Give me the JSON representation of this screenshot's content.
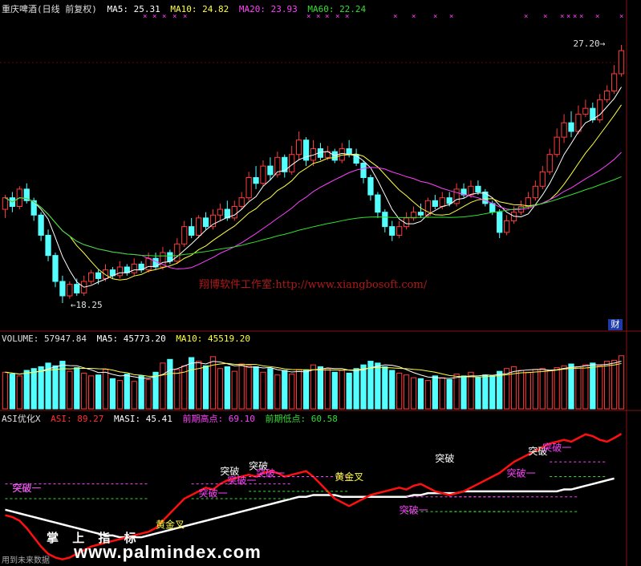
{
  "header": {
    "title": "重庆啤酒(日线 前复权)",
    "ma5": "MA5: 25.31",
    "ma10": "MA10: 24.82",
    "ma20": "MA20: 23.93",
    "ma60": "MA60: 22.24"
  },
  "volume_header": {
    "volume": "VOLUME: 57947.84",
    "ma5": "MA5: 45773.20",
    "ma10": "MA10: 45519.20"
  },
  "asi_header": {
    "name": "ASI优化X",
    "asi": "ASI: 89.27",
    "masi": "MASI: 45.41",
    "prev_high": "前期高点: 69.10",
    "prev_low": "前期低点: 60.58"
  },
  "watermark": "翔博软件工作室:http://www.xiangbosoft.com/",
  "finance_badge": "财",
  "logo_text": "掌 上 指 标",
  "site_text": "www.palmindex.com",
  "footer_text": "用到未来数据",
  "colors": {
    "up": "#ff3b3b",
    "down": "#54ffff",
    "ma5": "#ffffff",
    "ma10": "#ffff40",
    "ma20": "#ff40ff",
    "ma60": "#30e030",
    "asi": "#ff1010",
    "masi": "#ffffff",
    "grid": "#8a1010"
  },
  "chart_data": [
    {
      "type": "candlestick",
      "title": "重庆啤酒(日线 前复权)",
      "annotations": [
        {
          "label": "18.25",
          "kind": "low"
        },
        {
          "label": "27.20",
          "kind": "high"
        }
      ],
      "y_range": [
        17.5,
        28.2
      ],
      "candles": [
        [
          21.5,
          21.9,
          21.2,
          22.0
        ],
        [
          21.9,
          21.6,
          21.4,
          22.1
        ],
        [
          21.6,
          22.2,
          21.5,
          22.3
        ],
        [
          22.2,
          21.8,
          21.7,
          22.4
        ],
        [
          21.8,
          21.3,
          21.1,
          21.9
        ],
        [
          21.3,
          20.6,
          20.4,
          21.4
        ],
        [
          20.6,
          19.9,
          19.7,
          20.8
        ],
        [
          19.9,
          19.0,
          18.8,
          20.0
        ],
        [
          19.0,
          18.5,
          18.25,
          19.2
        ],
        [
          18.5,
          18.9,
          18.4,
          19.0
        ],
        [
          18.9,
          18.6,
          18.5,
          19.1
        ],
        [
          18.6,
          19.0,
          18.5,
          19.2
        ],
        [
          19.0,
          19.3,
          18.9,
          19.4
        ],
        [
          19.3,
          19.1,
          18.9,
          19.4
        ],
        [
          19.1,
          19.4,
          19.0,
          19.6
        ],
        [
          19.4,
          19.2,
          19.1,
          19.5
        ],
        [
          19.2,
          19.5,
          19.1,
          19.7
        ],
        [
          19.5,
          19.3,
          19.2,
          19.6
        ],
        [
          19.3,
          19.6,
          19.2,
          19.8
        ],
        [
          19.6,
          19.4,
          19.3,
          19.7
        ],
        [
          19.4,
          19.8,
          19.3,
          20.0
        ],
        [
          19.8,
          19.5,
          19.4,
          20.0
        ],
        [
          19.5,
          20.0,
          19.4,
          20.2
        ],
        [
          20.0,
          19.7,
          19.6,
          20.1
        ],
        [
          19.7,
          20.3,
          19.6,
          20.5
        ],
        [
          20.3,
          20.9,
          20.2,
          21.1
        ],
        [
          20.9,
          20.6,
          20.5,
          21.2
        ],
        [
          20.6,
          21.2,
          20.5,
          21.3
        ],
        [
          21.2,
          20.9,
          20.8,
          21.4
        ],
        [
          20.9,
          21.3,
          20.8,
          21.5
        ],
        [
          21.3,
          21.5,
          21.1,
          21.7
        ],
        [
          21.5,
          21.2,
          21.1,
          21.8
        ],
        [
          21.2,
          21.6,
          21.1,
          21.8
        ],
        [
          21.6,
          21.9,
          21.5,
          22.1
        ],
        [
          21.9,
          22.6,
          21.8,
          22.8
        ],
        [
          22.6,
          22.4,
          22.2,
          23.0
        ],
        [
          22.4,
          23.0,
          22.3,
          23.2
        ],
        [
          23.0,
          22.7,
          22.5,
          23.3
        ],
        [
          22.7,
          23.3,
          22.6,
          23.5
        ],
        [
          23.3,
          22.8,
          22.6,
          23.4
        ],
        [
          22.8,
          23.4,
          22.7,
          23.7
        ],
        [
          23.4,
          23.9,
          23.2,
          24.2
        ],
        [
          23.9,
          23.2,
          23.0,
          24.0
        ],
        [
          23.2,
          23.6,
          23.0,
          23.9
        ],
        [
          23.6,
          23.3,
          23.2,
          23.8
        ],
        [
          23.3,
          23.5,
          23.2,
          23.7
        ],
        [
          23.5,
          23.2,
          23.1,
          23.6
        ],
        [
          23.2,
          23.6,
          23.1,
          23.8
        ],
        [
          23.6,
          23.4,
          23.3,
          23.9
        ],
        [
          23.4,
          23.1,
          23.0,
          23.6
        ],
        [
          23.1,
          22.6,
          22.4,
          23.2
        ],
        [
          22.6,
          22.0,
          21.8,
          22.7
        ],
        [
          22.0,
          21.4,
          21.2,
          22.1
        ],
        [
          21.4,
          20.9,
          20.7,
          21.5
        ],
        [
          20.9,
          20.6,
          20.4,
          21.1
        ],
        [
          20.6,
          20.9,
          20.5,
          21.1
        ],
        [
          20.9,
          21.2,
          20.8,
          21.4
        ],
        [
          21.2,
          21.4,
          21.1,
          21.6
        ],
        [
          21.4,
          21.3,
          21.2,
          21.7
        ],
        [
          21.3,
          21.8,
          21.2,
          21.9
        ],
        [
          21.8,
          21.6,
          21.5,
          22.0
        ],
        [
          21.6,
          21.9,
          21.5,
          22.1
        ],
        [
          21.9,
          21.7,
          21.6,
          22.1
        ],
        [
          21.7,
          22.2,
          21.6,
          22.4
        ],
        [
          22.2,
          22.0,
          21.9,
          22.4
        ],
        [
          22.0,
          22.3,
          21.9,
          22.5
        ],
        [
          22.3,
          22.1,
          22.0,
          22.5
        ],
        [
          22.1,
          21.7,
          21.6,
          22.2
        ],
        [
          21.7,
          21.4,
          21.3,
          21.8
        ],
        [
          21.4,
          20.7,
          20.5,
          21.5
        ],
        [
          20.7,
          21.1,
          20.6,
          21.3
        ],
        [
          21.1,
          21.4,
          21.0,
          21.6
        ],
        [
          21.4,
          21.6,
          21.3,
          21.8
        ],
        [
          21.6,
          21.9,
          21.5,
          22.1
        ],
        [
          21.9,
          22.3,
          21.8,
          22.5
        ],
        [
          22.3,
          22.8,
          22.2,
          23.0
        ],
        [
          22.8,
          23.4,
          22.7,
          23.6
        ],
        [
          23.4,
          24.0,
          23.3,
          24.3
        ],
        [
          24.0,
          24.5,
          23.8,
          24.8
        ],
        [
          24.5,
          24.2,
          24.0,
          24.9
        ],
        [
          24.2,
          24.8,
          24.1,
          25.1
        ],
        [
          24.8,
          25.0,
          24.7,
          25.3
        ],
        [
          25.0,
          24.6,
          24.5,
          25.2
        ],
        [
          24.6,
          25.3,
          24.5,
          25.5
        ],
        [
          25.3,
          25.6,
          25.2,
          25.8
        ],
        [
          25.6,
          26.2,
          25.5,
          26.5
        ],
        [
          26.2,
          27.0,
          26.1,
          27.2
        ]
      ]
    },
    {
      "type": "bar",
      "title": "VOLUME",
      "y_range": [
        0,
        70000
      ],
      "values": [
        40000,
        38000,
        36000,
        42000,
        44000,
        46000,
        50000,
        47000,
        52000,
        41000,
        45000,
        39000,
        36000,
        37000,
        43000,
        33000,
        31000,
        38000,
        30000,
        36000,
        32000,
        40000,
        50000,
        54000,
        43000,
        47000,
        56000,
        52000,
        47000,
        57000,
        44000,
        46000,
        41000,
        49000,
        47000,
        46000,
        40000,
        44000,
        37000,
        42000,
        38000,
        43000,
        42000,
        48000,
        46000,
        44000,
        40000,
        42000,
        39000,
        44000,
        48000,
        52000,
        50000,
        46000,
        42000,
        39000,
        37000,
        34000,
        33000,
        31000,
        36000,
        34000,
        32000,
        38000,
        36000,
        40000,
        34000,
        37000,
        36000,
        41000,
        44000,
        46000,
        42000,
        40000,
        43000,
        44000,
        42000,
        45000,
        47000,
        49000,
        46000,
        48000,
        50000,
        47000,
        52000,
        53000,
        57948
      ],
      "ma5_last": 45773.2,
      "ma10_last": 45519.2
    },
    {
      "type": "line",
      "title": "ASI优化X",
      "y_range": [
        20,
        95
      ],
      "series": [
        {
          "name": "ASI",
          "values": [
            45,
            44,
            42,
            38,
            33,
            28,
            24,
            22,
            21,
            22,
            24,
            26,
            28,
            29,
            30,
            31,
            32,
            33,
            34,
            35,
            36,
            38,
            42,
            46,
            50,
            54,
            56,
            58,
            60,
            59,
            62,
            64,
            65,
            66,
            67,
            66,
            68,
            69,
            68,
            66,
            67,
            68,
            69,
            66,
            62,
            58,
            54,
            52,
            50,
            52,
            54,
            56,
            57,
            58,
            59,
            60,
            59,
            61,
            62,
            60,
            58,
            57,
            56,
            57,
            58,
            60,
            62,
            64,
            66,
            68,
            71,
            74,
            76,
            78,
            80,
            82,
            84,
            85,
            86,
            85,
            87,
            89,
            88,
            86,
            85,
            87,
            89.27
          ]
        },
        {
          "name": "MASI",
          "values": [
            48,
            47,
            46,
            45,
            44,
            43,
            42,
            41,
            40,
            39,
            38,
            37,
            36,
            35,
            34,
            34,
            33,
            33,
            33,
            33,
            34,
            35,
            36,
            37,
            38,
            39,
            40,
            41,
            42,
            43,
            44,
            45,
            46,
            47,
            48,
            49,
            50,
            51,
            52,
            53,
            54,
            55,
            55,
            56,
            56,
            56,
            56,
            55,
            55,
            55,
            55,
            55,
            55,
            55,
            55,
            55,
            55,
            56,
            56,
            57,
            57,
            57,
            57,
            57,
            58,
            58,
            58,
            58,
            58,
            58,
            58,
            58,
            58,
            58,
            58,
            58,
            58,
            58,
            59,
            59,
            60,
            61,
            62,
            63,
            64,
            65,
            45.41
          ]
        }
      ],
      "labels": [
        "突破",
        "突破一",
        "黄金叉",
        "突破一",
        "突破",
        "突破一",
        "突破",
        "突破一",
        "黄金叉",
        "突破一",
        "突破",
        "突破一",
        "突破",
        "突破一"
      ],
      "prev_high": 69.1,
      "prev_low": 60.58
    }
  ]
}
